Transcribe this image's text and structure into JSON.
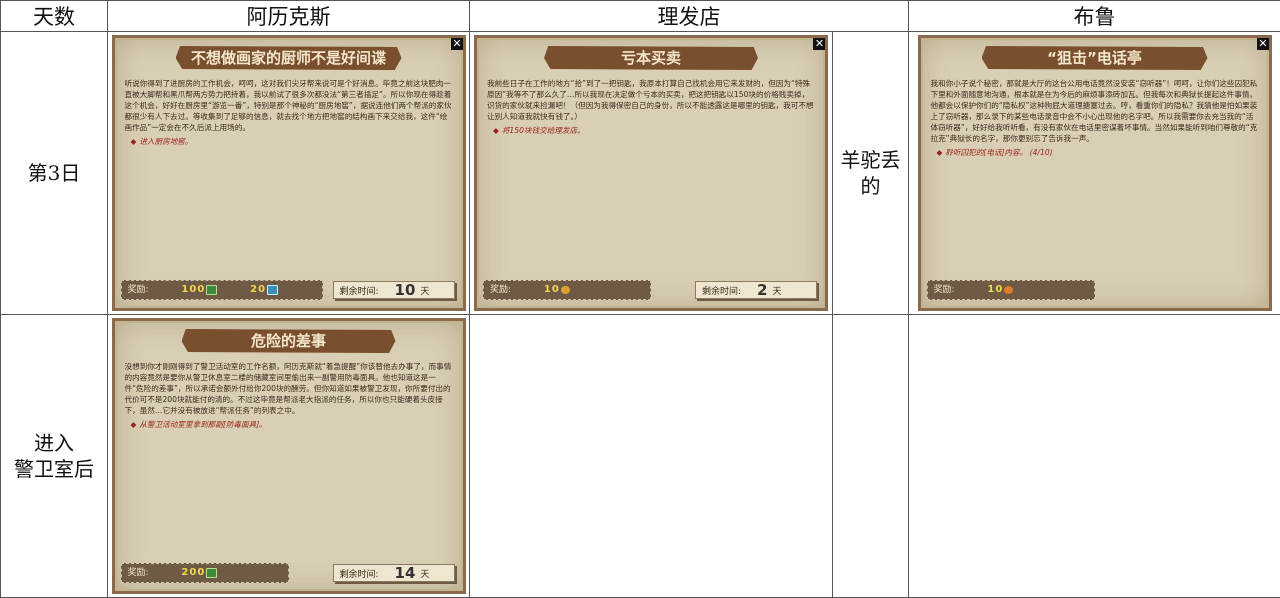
{
  "table": {
    "headers": [
      "天数",
      "阿历克斯",
      "理发店",
      "",
      "布鲁"
    ],
    "row1_label": "第3日",
    "row2_label_line1": "进入",
    "row2_label_line2": "警卫室后",
    "alpaca_text_line1": "羊驼丢",
    "alpaca_text_line2": "的"
  },
  "cards": {
    "chef": {
      "title": "不想做画家的厨师不是好间谍",
      "desc": "听说你得到了进厨房的工作机会，呵呵，这对我们尖牙帮来说可是个好消息。毕竟之前这块肥肉一直被大脚帮和黑爪帮两方势力把持着，我以前试了很多次都没法“第三者插足”。所以你现在得趁着这个机会，好好在厨房里“游览一番”，特别是那个神秘的“厨房地窖”，据说连他们两个帮派的家伙都很少有人下去过。等收集到了足够的信息，就去找个地方把地窖的结构画下来交给我，这件“绘画作品”一定会在不久后派上用场的。",
      "objective": "进入厨房地窖。",
      "reward_label": "奖励:",
      "reward1": "100",
      "reward2": "20",
      "time_label": "剩余时间:",
      "time_value": "10",
      "time_unit": "天"
    },
    "barber": {
      "title": "亏本买卖",
      "desc": "我前些日子在工作的地方“拾”到了一把钥匙，我原本打算自己找机会用它来发财的，但因为“特殊原因”我等不了那么久了…所以我现在决定做个亏本的买卖，把这把钥匙以150块的价格贱卖掉，识货的家伙就来捡漏吧！（但因为我得保密自己的身份，所以不能透露这是哪里的钥匙，我可不想让别人知道我就快有钱了。）",
      "objective": "将150块钱交给理发店。",
      "reward_label": "奖励:",
      "reward1": "10",
      "time_label": "剩余时间:",
      "time_value": "2",
      "time_unit": "天"
    },
    "blue": {
      "title": "“狙击”电话亭",
      "desc": "我和你小子说个秘密，那就是大厅的这台公用电话竟然没安装“窃听器”！呵呵，让你们这些囚犯私下里和外面随意地沟通，根本就是在为今后的麻烦事添砖加瓦。但我每次和典狱长提起这件事情，他都会以保护你们的“隐私权”这种狗屁大道理搪塞过去。哼，看重你们的隐私？我猜他是怕如果装上了窃听器，那么录下的某些电话录音中会不小心出现他的名字吧。所以我需要你去充当我的“活体窃听器”，好好给我听听看，有没有家伙在电话里密谋着坏事情。当然如果能听到咱们尊敬的“克拉克”典狱长的名字，那你更别忘了告诉我一声。",
      "objective": "聆听囚犯的[电话]内容。 (4/10)",
      "reward_label": "奖励:",
      "reward1": "10"
    },
    "danger": {
      "title": "危险的差事",
      "desc": "没想到你才刚刚得到了警卫活动室的工作名额，阿历克斯就“着急提醒”你该替他去办事了，而事情的内容竟然是要你从警卫休息室二楼的储藏室间里偷出来一副警用防毒面具。他也知道这是一件“危险的差事”，所以承诺会额外付给你200块的酬劳。但你知道如果被警卫发现，你所要付出的代价可不是200块就能付的清的。不过这毕竟是帮派老大指派的任务，所以你也只能硬着头皮接下，虽然…它并没有被放进“帮派任务”的列表之中。",
      "objective": "从警卫活动室里拿到那副[防毒面具]。",
      "reward_label": "奖励:",
      "reward1": "200",
      "time_label": "剩余时间:",
      "time_value": "14",
      "time_unit": "天"
    }
  },
  "icons": {
    "close": "close-icon",
    "money": "cash-icon",
    "gem": "gem-icon",
    "coin": "coin-icon",
    "star": "star-icon"
  },
  "colors": {
    "card_bg": "#d9cfb4",
    "banner": "#7a4f2e",
    "objective": "#9c1e1e",
    "reward_num": "#f2d84a"
  }
}
